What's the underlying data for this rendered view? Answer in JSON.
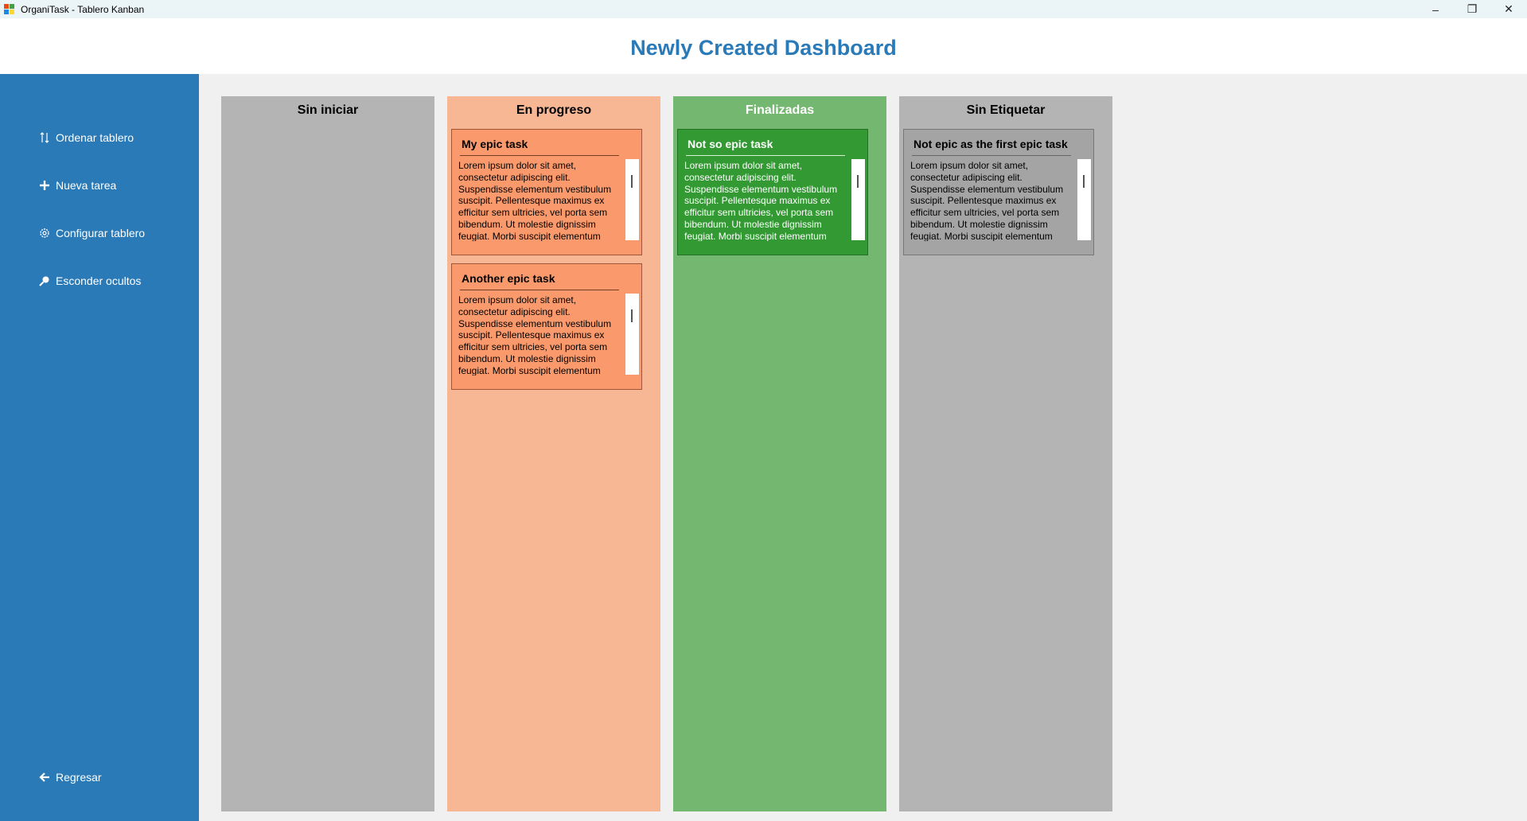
{
  "window": {
    "title": "OrganiTask - Tablero Kanban",
    "controls": [
      "–",
      "❐",
      "✕"
    ]
  },
  "header": {
    "title": "Newly Created Dashboard"
  },
  "sidebar": {
    "items": [
      {
        "label": "Ordenar tablero",
        "icon": "sort-icon"
      },
      {
        "label": "Nueva tarea",
        "icon": "plus-icon"
      },
      {
        "label": "Configurar tablero",
        "icon": "gear-icon"
      },
      {
        "label": "Esconder ocultos",
        "icon": "magnifier-icon"
      }
    ],
    "back": {
      "label": "Regresar",
      "icon": "arrow-left-icon"
    }
  },
  "colors": {
    "sidebar": "#2a7ab8",
    "col_gray": "#b4b4b4",
    "col_orange": "#f7b694",
    "card_orange": "#fa9a6c",
    "col_green": "#74b770",
    "card_green": "#339a33",
    "card_gray": "#a4a4a4"
  },
  "columns": [
    {
      "title": "Sin iniciar",
      "cards": []
    },
    {
      "title": "En progreso",
      "cards": [
        {
          "title": "My epic task",
          "body": "Lorem ipsum dolor sit amet, consectetur adipiscing elit. Suspendisse elementum vestibulum suscipit. Pellentesque maximus ex efficitur sem ultricies, vel porta sem bibendum. Ut molestie dignissim feugiat. Morbi suscipit elementum"
        },
        {
          "title": "Another epic task",
          "body": "Lorem ipsum dolor sit amet, consectetur adipiscing elit. Suspendisse elementum vestibulum suscipit. Pellentesque maximus ex efficitur sem ultricies, vel porta sem bibendum. Ut molestie dignissim feugiat. Morbi suscipit elementum"
        }
      ]
    },
    {
      "title": "Finalizadas",
      "cards": [
        {
          "title": "Not so epic task",
          "body": "Lorem ipsum dolor sit amet, consectetur adipiscing elit. Suspendisse elementum vestibulum suscipit. Pellentesque maximus ex efficitur sem ultricies, vel porta sem bibendum. Ut molestie dignissim feugiat. Morbi suscipit elementum"
        }
      ]
    },
    {
      "title": "Sin Etiquetar",
      "cards": [
        {
          "title": "Not epic as the first epic task",
          "body": "Lorem ipsum dolor sit amet, consectetur adipiscing elit. Suspendisse elementum vestibulum suscipit. Pellentesque maximus ex efficitur sem ultricies, vel porta sem bibendum. Ut molestie dignissim feugiat. Morbi suscipit elementum"
        }
      ]
    }
  ]
}
